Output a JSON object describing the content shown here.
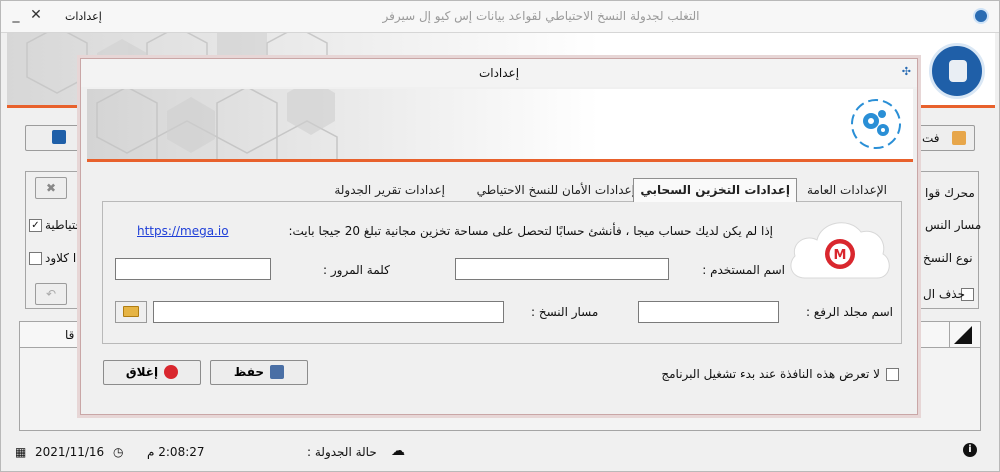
{
  "main_window": {
    "title": "التغلب لجدولة النسخ الاحتياطي لقواعد بيانات إس كيو إل سيرفر",
    "menu_label": "إعدادات",
    "background_labels": {
      "engine": "محرك قوا",
      "path": "مسار النس",
      "backup_type": "نوع النسخ",
      "delete": "حذف ال",
      "backup_check": "احتياطية",
      "cloud_check": "ا كلاود",
      "column": "قا",
      "button_label": "فت"
    },
    "status": {
      "date": "2021/11/16",
      "time": "2:08:27 م",
      "schedule_label": "حالة الجدولة :"
    }
  },
  "dialog": {
    "title": "إعدادات",
    "tabs": [
      {
        "label": "الإعدادات العامة",
        "active": false
      },
      {
        "label": "إعدادات التخزين السحابي",
        "active": true
      },
      {
        "label": "إعدادات الأمان للنسخ الاحتياطي",
        "active": false
      },
      {
        "label": "إعدادات تقرير الجدولة",
        "active": false
      }
    ],
    "cloud": {
      "info_text": "إذا لم يكن لديك حساب ميجا ، فأنشئ حسابًا لتحصل على مساحة تخزين مجانية تبلغ 20 جيجا بايت:",
      "link": "https://mega.io",
      "username_label": "اسم المستخدم :",
      "username_value": "",
      "password_label": "كلمة المرور :",
      "password_value": "",
      "upload_folder_label": "اسم مجلد الرفع :",
      "upload_folder_value": "",
      "backup_path_label": "مسار النسخ :",
      "backup_path_value": ""
    },
    "startup_checkbox_label": "لا تعرض هذه النافذة عند بدء تشغيل البرنامج",
    "save_label": "حفظ",
    "close_label": "إغلاق"
  },
  "colors": {
    "accent": "#e8612c",
    "brand_blue": "#1f5fa8",
    "mega_red": "#d9272e",
    "link": "#1f3fd8"
  }
}
